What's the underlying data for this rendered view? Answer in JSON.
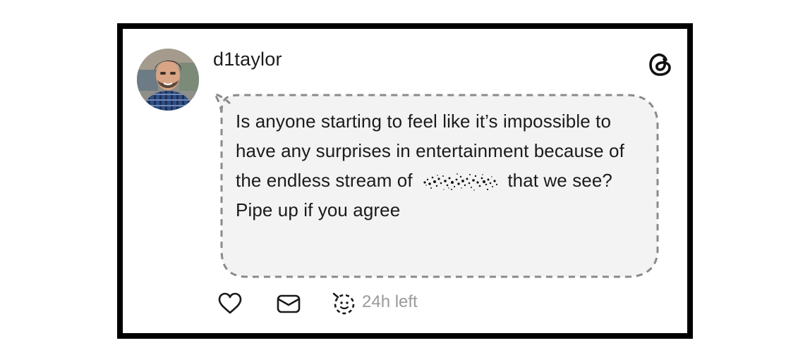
{
  "post": {
    "username": "d1taylor",
    "text_before_censor": "Is anyone starting to feel like it’s impossible to have any surprises in entertainment because of the endless stream of",
    "text_after_censor": "that we see? Pipe up if you agree",
    "time_left": "24h left"
  },
  "icons": {
    "brand": "threads-logo-icon",
    "like": "heart-icon",
    "message": "envelope-icon",
    "ephemeral": "dashed-smiley-icon",
    "censored": "redacted-noise"
  },
  "colors": {
    "frame": "#000000",
    "bubble_fill": "#f3f3f3",
    "bubble_border": "#8a8a8a",
    "muted_text": "#9a9a9a"
  }
}
